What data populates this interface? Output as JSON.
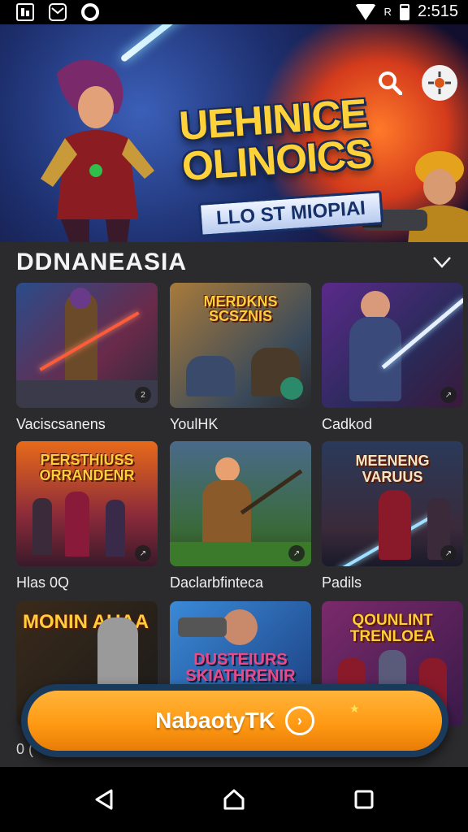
{
  "status_bar": {
    "left_icons": [
      "gallery-icon",
      "mail-icon",
      "gear-search-icon"
    ],
    "signal_label": "R",
    "time": "2:515"
  },
  "hero": {
    "title_line1": "UEHINICE",
    "title_line2": "OLINOICS",
    "subtitle": "LLO ST MIOPIAI",
    "icons": [
      "search-icon",
      "crosshair-icon"
    ]
  },
  "section": {
    "title": "DDNANEASIA",
    "icon": "chevron-down-icon"
  },
  "games": [
    {
      "label": "Vaciscsanens",
      "thumb_title": ""
    },
    {
      "label": "YoulHK",
      "thumb_title": "MERDKNS SCSZNIS"
    },
    {
      "label": "Cadkod",
      "thumb_title": ""
    },
    {
      "label": "Hlas 0Q",
      "thumb_title": "PERSTHIUSS ORRANDENR"
    },
    {
      "label": "Daclarbfinteca",
      "thumb_title": ""
    },
    {
      "label": "Padils",
      "thumb_title": "MEENENG VARUUS"
    },
    {
      "label": "",
      "thumb_title": "MONIN AUAA"
    },
    {
      "label": "",
      "thumb_title": "DUSTEIURS SKIATHRENIR"
    },
    {
      "label": "",
      "thumb_title": "QOUNLINT TRENLOEA"
    }
  ],
  "partial_label": "0 (",
  "cta": {
    "label": "NabaotyTK",
    "arrow_icon": "chevron-right-circle-icon",
    "star": "★"
  },
  "nav": [
    "back-icon",
    "home-icon",
    "recents-icon"
  ],
  "colors": {
    "accent": "#ff9a14",
    "title_gold": "#ffd23a",
    "background": "#2b2b2d"
  }
}
